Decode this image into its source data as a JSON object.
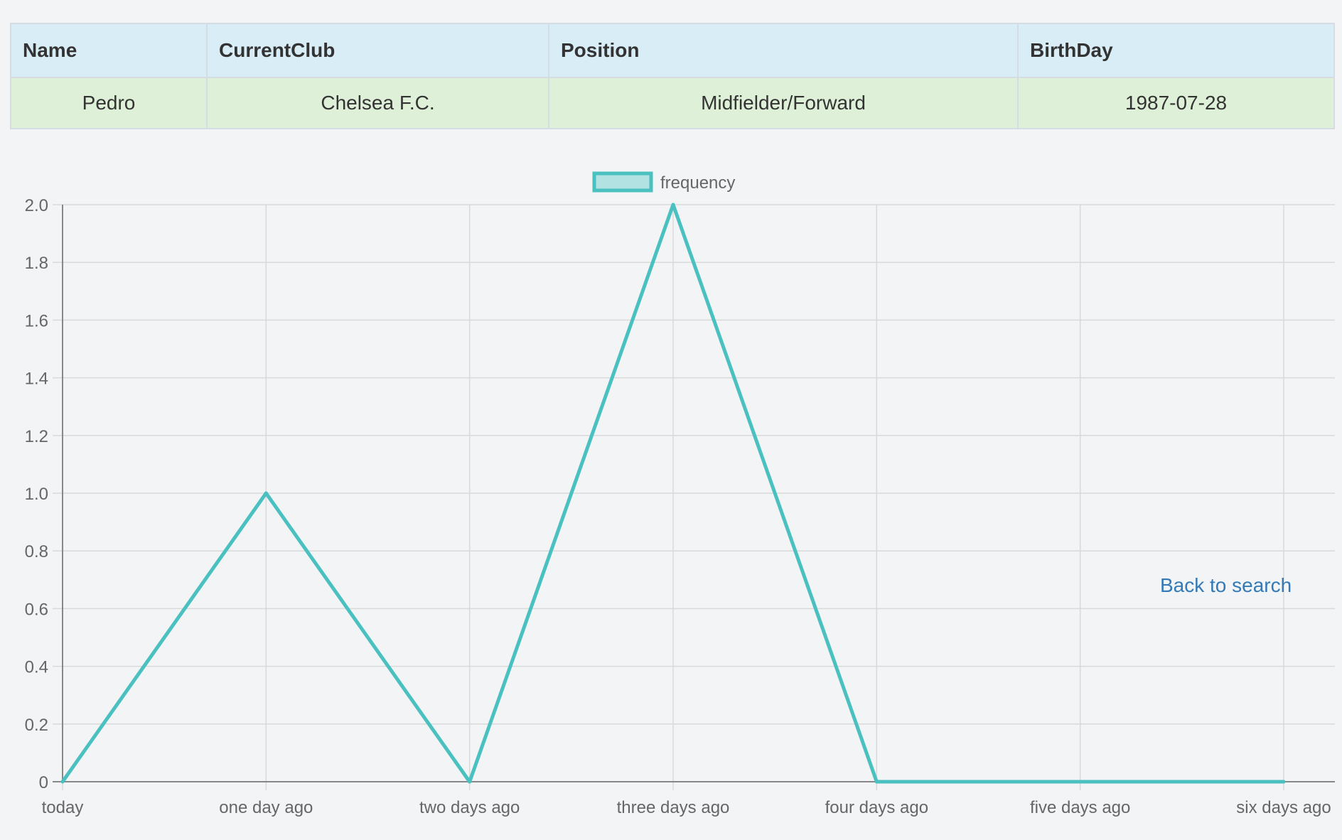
{
  "table": {
    "headers": [
      "Name",
      "CurrentClub",
      "Position",
      "BirthDay"
    ],
    "row": [
      "Pedro",
      "Chelsea F.C.",
      "Midfielder/Forward",
      "1987-07-28"
    ]
  },
  "back_link": "Back to search",
  "chart_data": {
    "type": "line",
    "categories": [
      "today",
      "one day ago",
      "two days ago",
      "three days ago",
      "four days ago",
      "five days ago",
      "six days ago"
    ],
    "series": [
      {
        "name": "frequency",
        "values": [
          0,
          1,
          0,
          2,
          0,
          0,
          0
        ]
      }
    ],
    "ylim": [
      0,
      2.0
    ],
    "yticks": [
      "0",
      "0.2",
      "0.4",
      "0.6",
      "0.8",
      "1.0",
      "1.2",
      "1.4",
      "1.6",
      "1.8",
      "2.0"
    ],
    "grid": true,
    "legend": "top-center",
    "colors": {
      "line": "#4bc0c0",
      "legend_fill": "#b2e2e2",
      "grid": "#d9d9d9",
      "axis": "#888888",
      "tick_text": "#666666"
    }
  }
}
